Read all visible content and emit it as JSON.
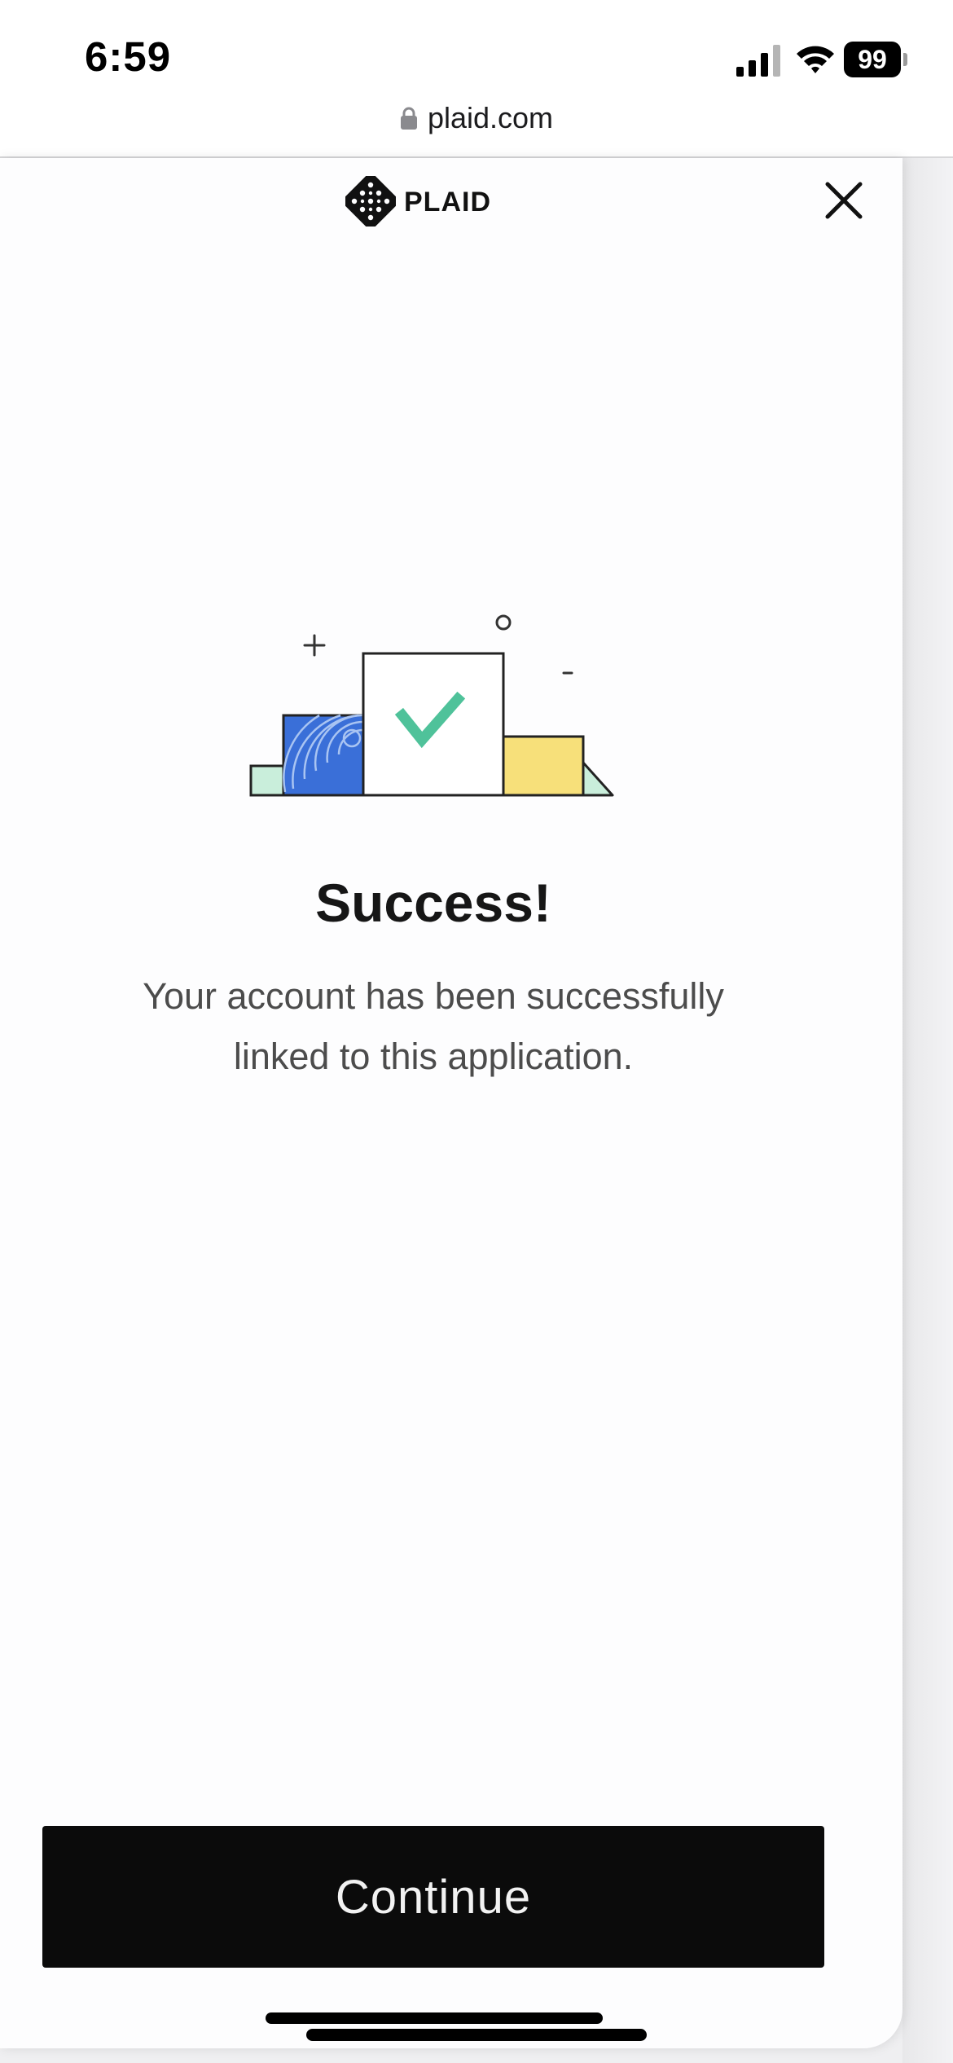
{
  "status_bar": {
    "time": "6:59",
    "battery_level": "99",
    "signal_bars_filled": 3,
    "signal_bars_total": 4
  },
  "browser": {
    "url": "plaid.com"
  },
  "header": {
    "logo_text": "PLAID",
    "close_icon": "close-icon"
  },
  "content": {
    "title": "Success!",
    "message_line1": "Your account has been successfully",
    "message_line2": "linked to this application."
  },
  "footer": {
    "continue_label": "Continue"
  },
  "colors": {
    "button_background": "#0b0b0b",
    "check_green": "#4fc29a",
    "illustration_blue": "#3a6fd8",
    "illustration_yellow": "#f7e07a",
    "illustration_mint": "#c9eedb"
  }
}
